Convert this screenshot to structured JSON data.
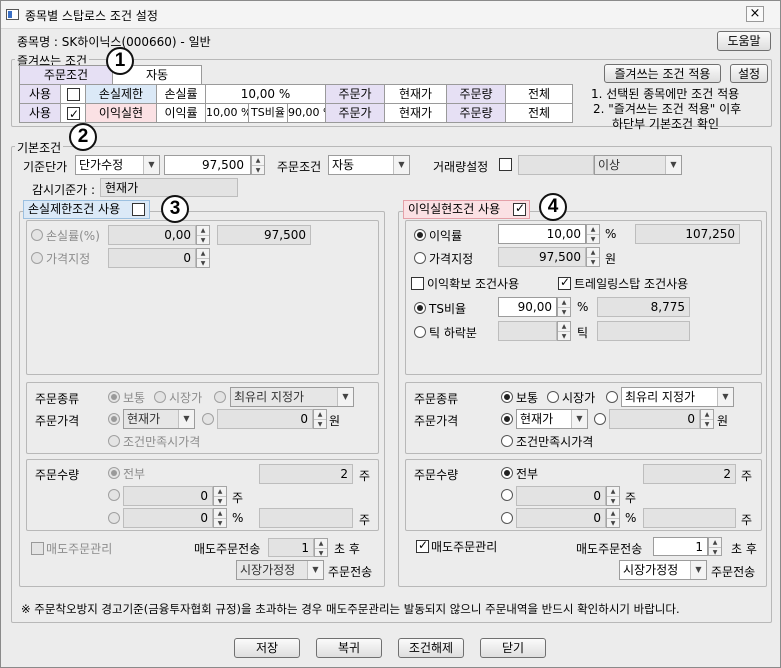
{
  "window": {
    "title": "종목별 스탑로스 조건 설정",
    "close": "×"
  },
  "header": {
    "stock_label": "종목명 : SK하이닉스(000660) - 일반",
    "help_button": "도움말"
  },
  "badges": [
    "1",
    "2",
    "3",
    "4"
  ],
  "favorites": {
    "legend": "즐겨쓰는 조건",
    "order_cond_label": "주문조건",
    "order_cond_value": "자동",
    "row1": [
      "사용",
      "",
      "손실제한",
      "손실률",
      "10,00 %",
      "주문가",
      "현재가",
      "주문량",
      "전체"
    ],
    "row2": [
      "사용",
      "",
      "이익실현",
      "이익률",
      "10,00 %",
      "TS비율",
      "90,00 %",
      "주문가",
      "현재가",
      "주문량",
      "전체"
    ],
    "apply_button": "즐겨쓰는 조건 적용",
    "settings_button": "설정",
    "notes": [
      "1. 선택된 종목에만 조건 적용",
      "2. \"즐겨쓰는 조건 적용\" 이후",
      "하단부 기본조건 확인"
    ]
  },
  "basic": {
    "legend": "기본조건",
    "base_price_label": "기준단가",
    "base_price_type": "단가수정",
    "base_price_value": "97,500",
    "order_cond_label": "주문조건",
    "order_cond_value": "자동",
    "volume_label": "거래량설정",
    "volume_compare": "이상",
    "monitor_label": "감시기준가 :",
    "monitor_value": "현재가"
  },
  "loss": {
    "title": "손실제한조건 사용",
    "rate_label": "손실률(%)",
    "rate_value": "0,00",
    "rate_price": "97,500",
    "price_label": "가격지정",
    "price_value": "0",
    "order_type_label": "주문종류",
    "normal": "보통",
    "market": "시장가",
    "limit_type": "최유리 지정가",
    "order_price_label": "주문가격",
    "price_type": "현재가",
    "price_offset": "0",
    "won": "원",
    "cond_price": "조건만족시가격",
    "qty_label": "주문수량",
    "all": "전부",
    "qty_all": "2",
    "ju": "주",
    "qty_count": "0",
    "qty_pct": "0",
    "pct": "%",
    "sell_mgmt": "매도주문관리",
    "resend_label": "매도주문전송",
    "resend_value": "1",
    "after": "초 후",
    "resend_type": "시장가정정",
    "resend_suffix": "주문전송"
  },
  "profit": {
    "title": "이익실현조건 사용",
    "rate_label": "이익률",
    "rate_value": "10,00",
    "pct": "%",
    "rate_price": "107,250",
    "price_label": "가격지정",
    "price_value": "97,500",
    "won": "원",
    "secure_label": "이익확보 조건사용",
    "trailing_label": "트레일링스탑 조건사용",
    "ts_label": "TS비율",
    "ts_value": "90,00",
    "ts_price": "8,775",
    "tick_label": "틱 하락분",
    "tick_suffix": "틱",
    "order_type_label": "주문종류",
    "normal": "보통",
    "market": "시장가",
    "limit_type": "최유리 지정가",
    "order_price_label": "주문가격",
    "price_type": "현재가",
    "price_offset": "0",
    "cond_price": "조건만족시가격",
    "qty_label": "주문수량",
    "all": "전부",
    "qty_all": "2",
    "ju": "주",
    "qty_count": "0",
    "qty_pct": "0",
    "sell_mgmt": "매도주문관리",
    "resend_label": "매도주문전송",
    "resend_value": "1",
    "after": "초 후",
    "resend_type": "시장가정정",
    "resend_suffix": "주문전송"
  },
  "footer": {
    "notice": "※ 주문착오방지 경고기준(금융투자협회 규정)을 초과하는 경우 매도주문관리는 발동되지 않으니 주문내역을 반드시 확인하시기 바랍니다.",
    "save": "저장",
    "restore": "복귀",
    "release": "조건해제",
    "close": "닫기"
  },
  "colors": {
    "loss_header": "#dbe9f7",
    "profit_header": "#fbe1e4",
    "order_cell": "#e6e0f4",
    "badge_border": "#111111"
  },
  "icons": [
    "app-icon",
    "close-icon",
    "checkbox-icon",
    "radio-icon",
    "dropdown-arrow-icon",
    "spin-up-icon",
    "spin-down-icon"
  ]
}
